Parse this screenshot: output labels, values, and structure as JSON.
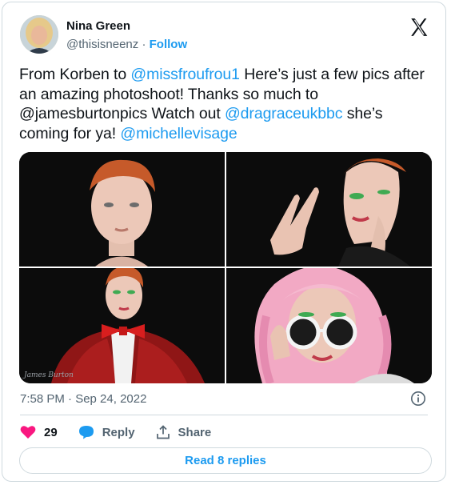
{
  "author": {
    "name": "Nina Green",
    "handle": "@thisisneenz",
    "separator": "·",
    "follow_label": "Follow"
  },
  "tweet": {
    "segments": [
      {
        "text": "From Korben to ",
        "link": false
      },
      {
        "text": "@missfroufrou1",
        "link": true
      },
      {
        "text": " Here’s just a few pics after an amazing photoshoot! Thanks so much to @jamesburtonpics Watch out ",
        "link": false
      },
      {
        "text": "@dragraceukbbc",
        "link": true
      },
      {
        "text": " she’s coming for ya! ",
        "link": false
      },
      {
        "text": "@michellevisage",
        "link": true
      }
    ]
  },
  "media": {
    "watermark": "James Burton",
    "photos": [
      "photo-portrait-redhead",
      "photo-makeup-hand-pose",
      "photo-red-sequin-jacket",
      "photo-pink-wig-sunglasses"
    ]
  },
  "meta": {
    "timestamp": "7:58 PM · Sep 24, 2022"
  },
  "actions": {
    "like_count": "29",
    "reply_label": "Reply",
    "share_label": "Share"
  },
  "footer": {
    "read_replies_label": "Read 8 replies"
  },
  "colors": {
    "accent": "#1d9bf0",
    "like": "#f91880",
    "text": "#0f1419",
    "secondary": "#536471",
    "border": "#cfd9de"
  },
  "icons": [
    "x-logo-icon",
    "info-icon",
    "heart-icon",
    "reply-bubble-icon",
    "share-icon"
  ]
}
